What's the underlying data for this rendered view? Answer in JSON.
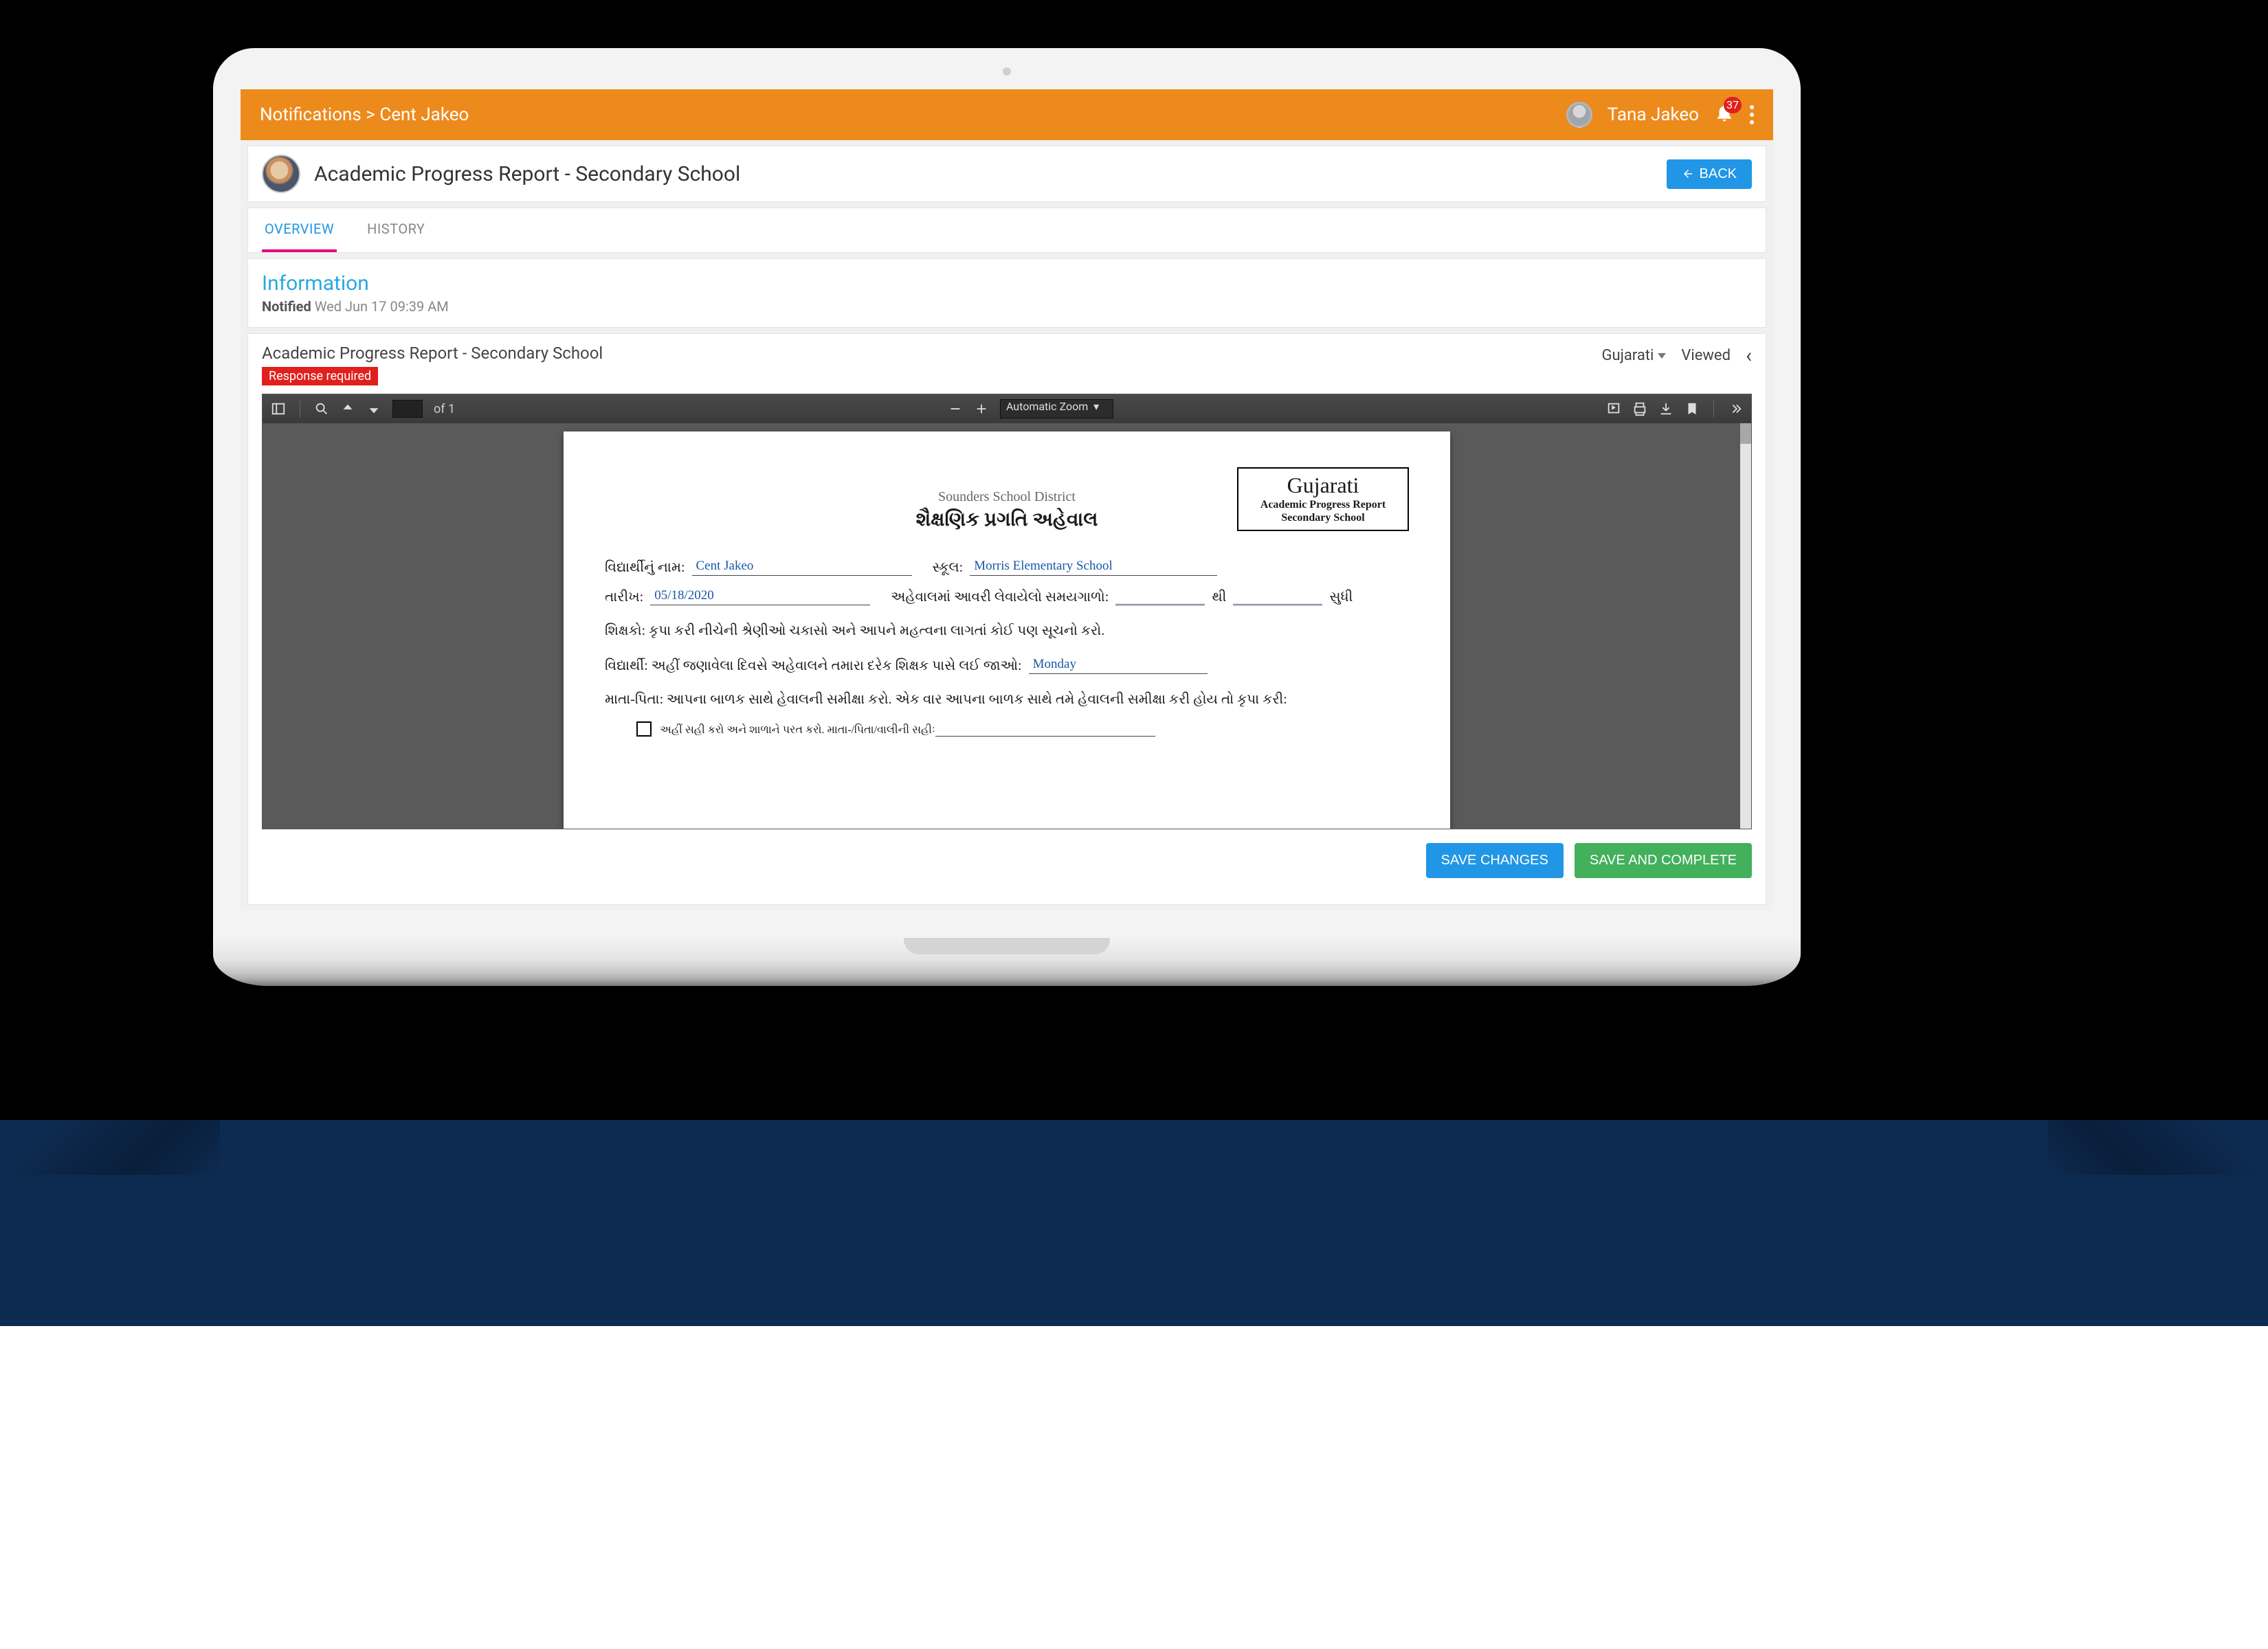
{
  "header": {
    "breadcrumb_root": "Notifications",
    "breadcrumb_sep": " > ",
    "breadcrumb_leaf": "Cent Jakeo",
    "username": "Tana Jakeo",
    "notif_count": "37"
  },
  "title": {
    "text": "Academic Progress Report - Secondary School",
    "back_label": "BACK"
  },
  "tabs": {
    "overview": "OVERVIEW",
    "history": "HISTORY"
  },
  "info": {
    "heading": "Information",
    "notified_label": "Notified",
    "notified_value": "Wed Jun 17 09:39 AM"
  },
  "doc": {
    "title": "Academic Progress Report - Secondary School",
    "tag": "Response required",
    "language": "Gujarati",
    "status": "Viewed"
  },
  "pdf_toolbar": {
    "page_value": "",
    "of": "of",
    "total": "1",
    "zoom": "Automatic Zoom"
  },
  "pdf_page": {
    "lang_big": "Gujarati",
    "lang_sm1": "Academic Progress Report",
    "lang_sm2": "Secondary School",
    "district": "Sounders School District",
    "title_gu": "શૈક્ષણિક પ્રગતિ અહેવાલ",
    "name_label": "વિદ્યાર્થીનું નામ:",
    "name_value": "Cent Jakeo",
    "school_label": "સ્કૂલ:",
    "school_value": "Morris Elementary School",
    "date_label": "તારીખ:",
    "date_value": "05/18/2020",
    "period_label": "અહેવાલમાં આવરી લેવાયેલો સમયગાળો:",
    "thi": "થી",
    "sudhi": "સુધી",
    "teachers_line": "શિક્ષકો: કૃપા કરી નીચેની શ્રેણીઓ ચકાસો અને આપને મહત્વના લાગતાં કોઈ પણ સૂચનો કરો.",
    "student_line": "વિદ્યાર્થી: અહીં જણાવેલા દિવસે અહેવાલને તમારા દરેક શિક્ષક પાસે લઈ જાઓ:",
    "student_value": "Monday",
    "parent_line": "માતા-પિતા: આપના બાળક સાથે હેવાલની સમીક્ષા કરો. એક વાર આપના બાળક સાથે તમે હેવાલની સમીક્ષા કરી હોય તો કૃપા કરી:",
    "checkbox_line": "અહીં સહી કરો અને શાળાને પરત કરો. માતા-/પિતા/વાલીની સહીઃ"
  },
  "footer": {
    "save": "SAVE CHANGES",
    "complete": "SAVE AND COMPLETE"
  }
}
